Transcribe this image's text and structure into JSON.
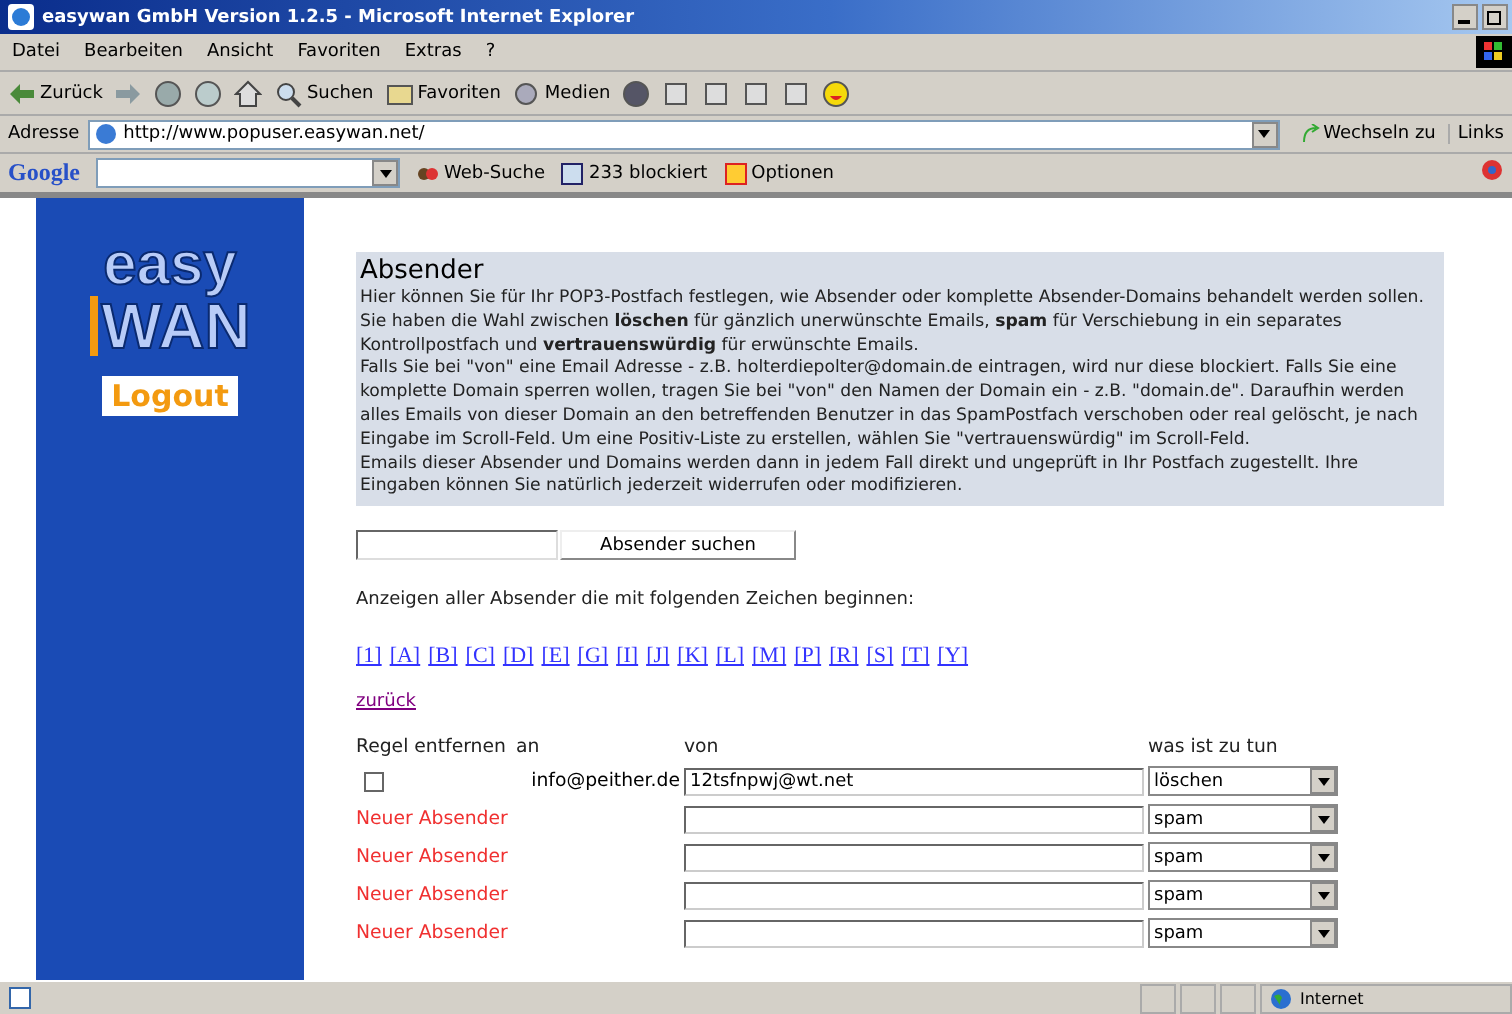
{
  "window": {
    "title": "easywan GmbH Version 1.2.5 - Microsoft Internet Explorer"
  },
  "menu": [
    {
      "label": "Datei"
    },
    {
      "label": "Bearbeiten"
    },
    {
      "label": "Ansicht"
    },
    {
      "label": "Favoriten"
    },
    {
      "label": "Extras"
    },
    {
      "label": "?"
    }
  ],
  "toolbar": [
    {
      "kind": "back",
      "label": "Zurück"
    },
    {
      "kind": "forward"
    },
    {
      "kind": "stop"
    },
    {
      "kind": "refresh"
    },
    {
      "kind": "home"
    },
    {
      "kind": "search",
      "label": "Suchen"
    },
    {
      "kind": "favorites",
      "label": "Favoriten"
    },
    {
      "kind": "media",
      "label": "Medien"
    },
    {
      "kind": "history"
    },
    {
      "kind": "mail"
    },
    {
      "kind": "print"
    },
    {
      "kind": "edit"
    },
    {
      "kind": "note"
    },
    {
      "kind": "smiley"
    }
  ],
  "address": {
    "label": "Adresse",
    "value": "http://www.popuser.easywan.net/",
    "go": "Wechseln zu",
    "links": "Links"
  },
  "google_bar": {
    "logo": "Google",
    "search": "Web-Suche",
    "blocked": "233 blockiert",
    "options": "Optionen"
  },
  "sidebar": {
    "logo_top": "easy",
    "logo_bottom": "WAN",
    "logout": "Logout"
  },
  "info": {
    "heading": "Absender",
    "paragraphs": [
      "Hier können Sie für Ihr POP3-Postfach festlegen, wie Absender oder komplette Absender-Domains behandelt werden sollen. Sie haben die Wahl zwischen **löschen** für gänzlich unerwünschte Emails, **spam** für Verschiebung in ein separates Kontrollpostfach und **vertrauenswürdig** für erwünschte Emails.",
      "Falls Sie bei \"von\" eine Email Adresse - z.B. holterdiepolter@domain.de eintragen, wird nur diese blockiert. Falls Sie eine komplette Domain sperren wollen, tragen Sie bei \"von\" den Namen der Domain ein - z.B. \"domain.de\". Daraufhin werden alles Emails von dieser Domain an den betreffenden Benutzer in das SpamPostfach verschoben oder real gelöscht, je nach Eingabe im Scroll-Feld. Um eine Positiv-Liste zu erstellen, wählen Sie \"vertrauenswürdig\" im Scroll-Feld.",
      "Emails dieser Absender und Domains werden dann in jedem Fall direkt und ungeprüft in Ihr Postfach zugestellt. Ihre Eingaben können Sie natürlich jederzeit widerrufen oder modifizieren."
    ]
  },
  "search": {
    "button": "Absender suchen"
  },
  "filter": {
    "label": "Anzeigen aller Absender die mit folgenden Zeichen beginnen:",
    "letters": [
      "[1]",
      "[A]",
      "[B]",
      "[C]",
      "[D]",
      "[E]",
      "[G]",
      "[I]",
      "[J]",
      "[K]",
      "[L]",
      "[M]",
      "[P]",
      "[R]",
      "[S]",
      "[T]",
      "[Y]"
    ]
  },
  "back_link": "zurück",
  "table": {
    "columns": [
      "Regel entfernen",
      "an",
      "von",
      "was ist zu tun"
    ],
    "rows": [
      {
        "kind": "existing",
        "checked": false,
        "address": "info@peither.de",
        "from": "12tsfnpwj@wt.net",
        "action": "löschen"
      },
      {
        "kind": "new",
        "label": "Neuer Absender",
        "action": "spam"
      },
      {
        "kind": "new",
        "label": "Neuer Absender",
        "action": "spam"
      },
      {
        "kind": "new",
        "label": "Neuer Absender",
        "action": "spam"
      },
      {
        "kind": "new",
        "label": "Neuer Absender",
        "action": "spam"
      }
    ]
  },
  "status_bar": {
    "zone": "Internet"
  }
}
